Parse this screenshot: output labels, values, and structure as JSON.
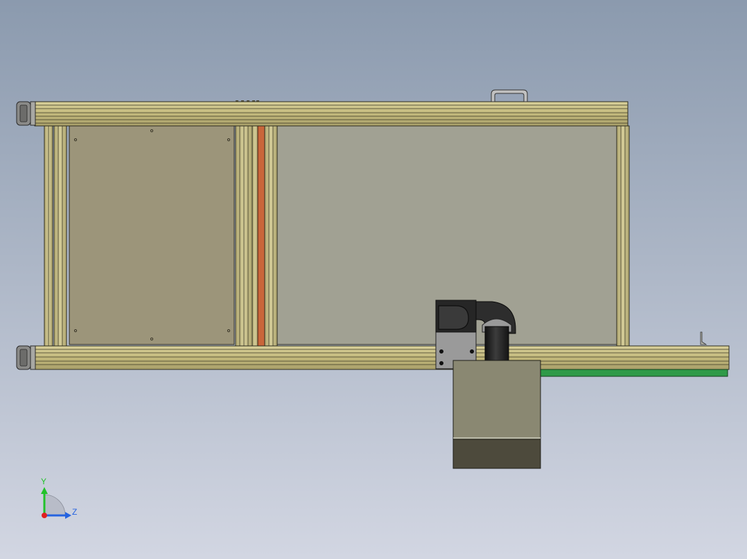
{
  "viewport": {
    "background_top": "#8b9aae",
    "background_bottom": "#d2d6e2"
  },
  "model": {
    "frame_color": "#c8bf82",
    "frame_edge": "#2e2c1e",
    "panel_left_color": "#9c957a",
    "panel_right_color": "#a1a193",
    "orange_strip_color": "#c9663a",
    "green_strip_color": "#2f9a48",
    "elbow_color": "#2d2d2d",
    "box_color": "#8a8872",
    "box_base_color": "#4d4a3c"
  },
  "triad": {
    "y_label": "Y",
    "z_label": "Z",
    "y_color": "#22c22a",
    "z_color": "#2563e0",
    "x_color": "#e02020"
  }
}
